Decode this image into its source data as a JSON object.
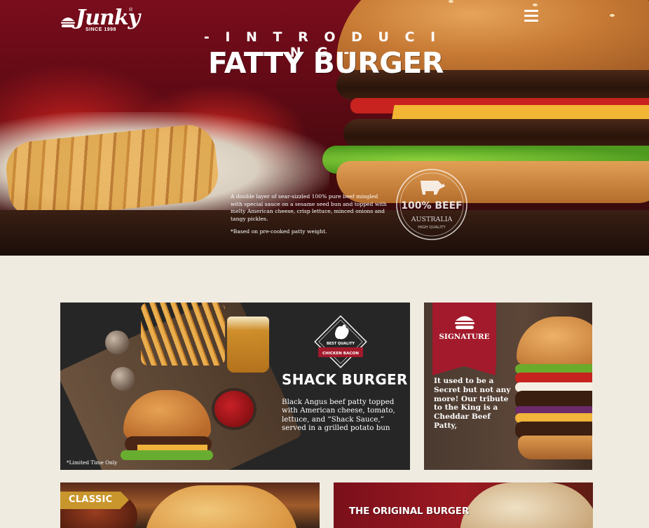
{
  "brand": {
    "name": "Junky",
    "tagline": "SINCE 1998",
    "registered": "®"
  },
  "nav": {
    "menu_icon": "hamburger-menu-icon"
  },
  "hero": {
    "kicker": "- I N T R O D U C I N G -",
    "title": "FATTY BURGER",
    "description": "A double layer of sear-sizzled 100% pure beef mingled with special sauce on a sesame seed bun and topped with melty American cheese, crisp lettuce, minced onions and tangy pickles.",
    "note": "*Based on pre-cooked patty weight.",
    "seal": {
      "headline": "100% BEEF",
      "country": "AUSTRALIA",
      "quality": "HIGH QUALITY"
    }
  },
  "cards": {
    "shack": {
      "badge_top": "BEST QUALITY",
      "badge_ribbon": "CHICKEN BACON",
      "title": "SHACK BURGER",
      "description": "Black Angus beef patty topped with American cheese, tomato, lettuce, and “Shack Sauce,” served in a grilled potato bun",
      "note": "*Limited Time Only"
    },
    "signature": {
      "label": "SIGNATURE",
      "description": "It used to be a Secret but not any more! Our tribute to the King is a Cheddar Beef Patty,"
    },
    "classic": {
      "label": "CLASSIC"
    },
    "original": {
      "label": "THE ORIGINAL BURGER"
    }
  },
  "colors": {
    "hero_red": "#7a0d1c",
    "page_bg": "#efebe1",
    "ribbon_red": "#a31a2c",
    "gold": "#c9962d",
    "dark_card": "#262626"
  }
}
